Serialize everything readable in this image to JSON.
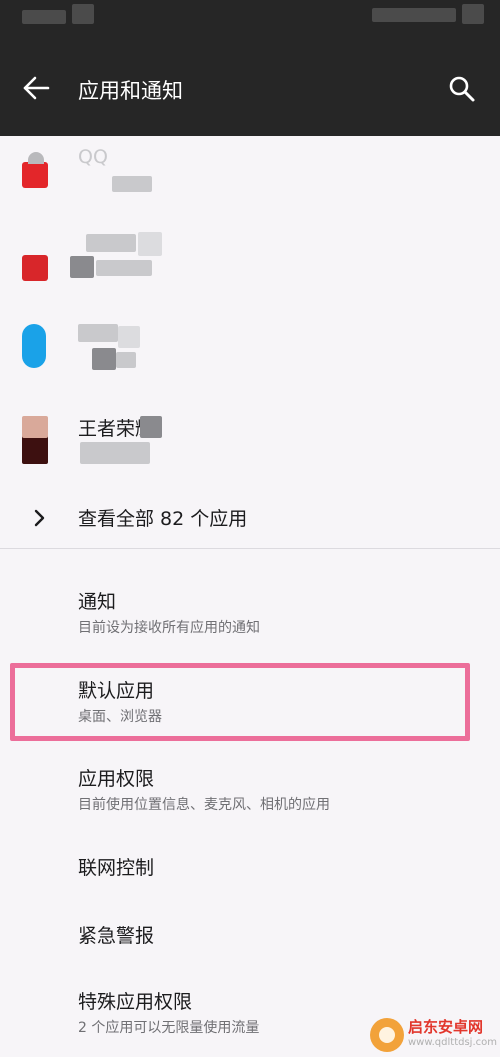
{
  "header": {
    "title": "应用和通知",
    "back_icon": "back-arrow-icon",
    "search_icon": "search-icon"
  },
  "recent_apps": [
    {
      "name": "QQ",
      "icon_color": "#e3262a"
    },
    {
      "name": "",
      "icon_color": "#d8262a"
    },
    {
      "name": "",
      "icon_color": "#1aa2e8"
    },
    {
      "name": "王者荣耀",
      "icon_color": "#3d1010"
    }
  ],
  "see_all": {
    "label": "查看全部 82 个应用",
    "icon": "chevron-right-icon"
  },
  "settings": [
    {
      "title": "通知",
      "subtitle": "目前设为接收所有应用的通知"
    },
    {
      "title": "默认应用",
      "subtitle": "桌面、浏览器"
    },
    {
      "title": "应用权限",
      "subtitle": "目前使用位置信息、麦克风、相机的应用"
    },
    {
      "title": "联网控制",
      "subtitle": ""
    },
    {
      "title": "紧急警报",
      "subtitle": ""
    },
    {
      "title": "特殊应用权限",
      "subtitle": "2 个应用可以无限量使用流量"
    }
  ],
  "highlight_color": "#ec6e9a",
  "watermark": {
    "text": "启东安卓网",
    "url": "www.qdlttdsj.com"
  }
}
